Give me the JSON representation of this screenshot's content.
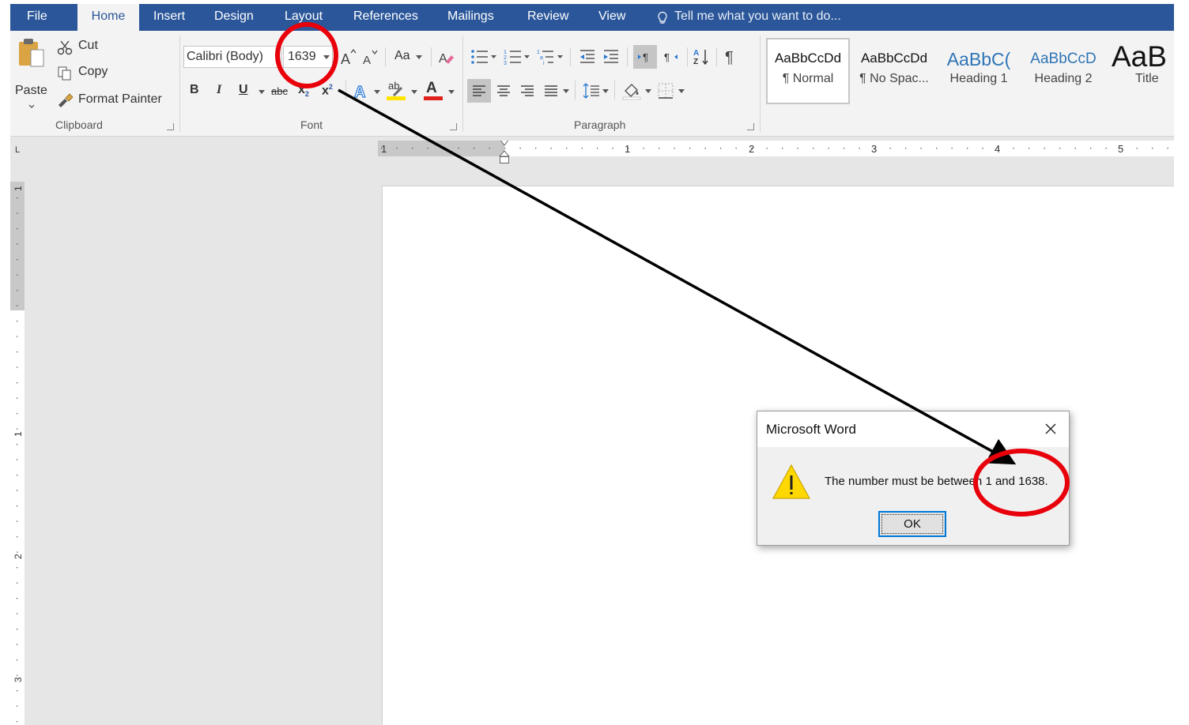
{
  "tabs": [
    {
      "label": "File",
      "name": "tab-file"
    },
    {
      "label": "Home",
      "name": "tab-home"
    },
    {
      "label": "Insert",
      "name": "tab-insert"
    },
    {
      "label": "Design",
      "name": "tab-design"
    },
    {
      "label": "Layout",
      "name": "tab-layout"
    },
    {
      "label": "References",
      "name": "tab-references"
    },
    {
      "label": "Mailings",
      "name": "tab-mailings"
    },
    {
      "label": "Review",
      "name": "tab-review"
    },
    {
      "label": "View",
      "name": "tab-view"
    }
  ],
  "tell_me": {
    "icon": "lightbulb-icon",
    "placeholder": "Tell me what you want to do..."
  },
  "clipboard": {
    "group_label": "Clipboard",
    "paste": "Paste",
    "cut": "Cut",
    "copy": "Copy",
    "format_painter": "Format Painter"
  },
  "font": {
    "group_label": "Font",
    "font_name": "Calibri (Body)",
    "font_size": "1639",
    "change_case": "Aa",
    "bold": "B",
    "italic": "I",
    "underline": "U",
    "strikethrough": "abc",
    "subscript": "x",
    "superscript": "x",
    "text_color": "A",
    "highlight": "ab"
  },
  "paragraph": {
    "group_label": "Paragraph"
  },
  "styles": [
    {
      "preview": "AaBbCcDd",
      "label": "¶ Normal",
      "name": "style-normal"
    },
    {
      "preview": "AaBbCcDd",
      "label": "¶ No Spac...",
      "name": "style-no-spacing"
    },
    {
      "preview": "AaBbC(",
      "label": "Heading 1",
      "name": "style-heading-1"
    },
    {
      "preview": "AaBbCcD",
      "label": "Heading 2",
      "name": "style-heading-2"
    },
    {
      "preview": "AaB",
      "label": "Title",
      "name": "style-title"
    }
  ],
  "ruler": {
    "tab_selector": "L",
    "h_numbers": [
      "1",
      "1",
      "2",
      "3",
      "4",
      "5"
    ],
    "v_numbers": [
      "1",
      "1",
      "2",
      "3"
    ]
  },
  "dialog": {
    "title": "Microsoft Word",
    "message": "The number must be between 1 and 1638.",
    "ok": "OK",
    "icon": "warning-icon",
    "close_icon": "close-icon"
  },
  "annotations": {
    "highlight_color": "#e8000b",
    "arrow_color": "#000000",
    "circles": [
      "font-size-highlight-circle",
      "limit-highlight-circle"
    ]
  },
  "colors": {
    "tab_bar": "#2b579a",
    "ribbon": "#f3f3f3",
    "workspace": "#e6e6e6",
    "text_color_underline": "#e0201b",
    "highlight_underline": "#ffe400"
  }
}
